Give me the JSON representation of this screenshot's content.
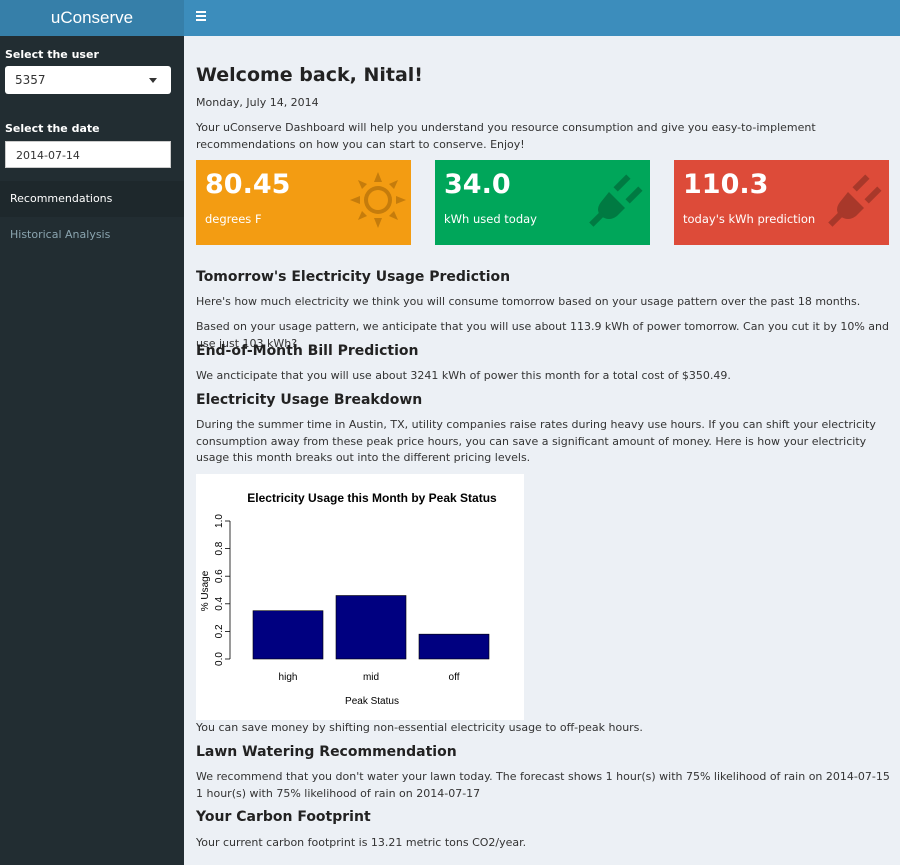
{
  "app": {
    "title": "uConserve"
  },
  "sidebar": {
    "user_label": "Select the user",
    "user_value": "5357",
    "date_label": "Select the date",
    "date_value": "2014-07-14",
    "menu": [
      {
        "label": "Recommendations"
      },
      {
        "label": "Historical Analysis"
      }
    ]
  },
  "main": {
    "welcome": "Welcome back, Nital!",
    "date": "Monday, July 14, 2014",
    "intro": "Your uConserve Dashboard will help you understand you resource consumption and give you easy-to-implement recommendations on how you can start to conserve. Enjoy!",
    "boxes": [
      {
        "value": "80.45",
        "label": "degrees F",
        "icon": "sun-icon",
        "color": "#f39c12"
      },
      {
        "value": "34.0",
        "label": "kWh used today",
        "icon": "plug-icon",
        "color": "#00a65a"
      },
      {
        "value": "110.3",
        "label": "today's kWh prediction",
        "icon": "plug-icon",
        "color": "#dd4b39"
      }
    ],
    "sections": {
      "tomorrow_title": "Tomorrow's Electricity Usage Prediction",
      "tomorrow_p1": "Here's how much electricity we think you will consume tomorrow based on your usage pattern over the past 18 months.",
      "tomorrow_p2": "Based on your usage pattern, we anticipate that you will use about 113.9 kWh of power tomorrow. Can you cut it by 10% and use just 103 kWh?",
      "bill_title": "End-of-Month Bill Prediction",
      "bill_p": "We ancticipate that you will use about 3241 kWh of power this month for a total cost of $350.49.",
      "breakdown_title": "Electricity Usage Breakdown",
      "breakdown_p": "During the summer time in Austin, TX, utility companies raise rates during heavy use hours. If you can shift your electricity consumption away from these peak price hours, you can save a significant amount of money. Here is how your electricity usage this month breaks out into the different pricing levels.",
      "shift_p": "You can save money by shifting non-essential electricity usage to off-peak hours.",
      "lawn_title": "Lawn Watering Recommendation",
      "lawn_p": "We recommend that you don't water your lawn today. The forecast shows 1 hour(s) with 75% likelihood of rain on 2014-07-15 1 hour(s) with 75% likelihood of rain on 2014-07-17",
      "carbon_title": "Your Carbon Footprint",
      "carbon_p": "Your current carbon footprint is 13.21 metric tons CO2/year."
    }
  },
  "chart_data": {
    "type": "bar",
    "title": "Electricity Usage this Month by Peak Status",
    "xlabel": "Peak Status",
    "ylabel": "% Usage",
    "categories": [
      "high",
      "mid",
      "off"
    ],
    "values": [
      0.35,
      0.46,
      0.18
    ],
    "ylim": [
      0,
      1.0
    ],
    "yticks": [
      "0.0",
      "0.2",
      "0.4",
      "0.6",
      "0.8",
      "1.0"
    ],
    "bar_color": "#000080"
  }
}
